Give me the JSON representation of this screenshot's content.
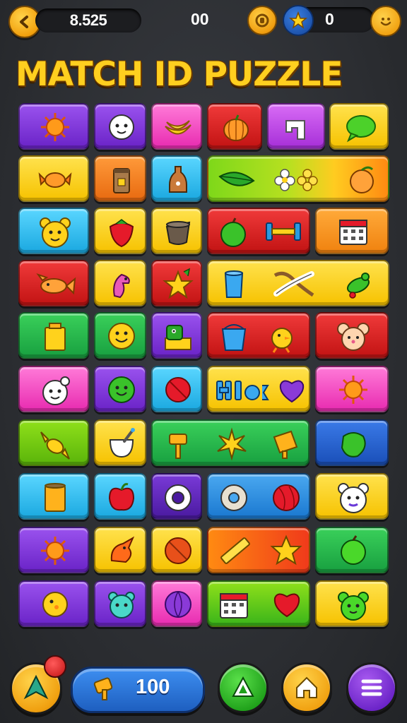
{
  "header": {
    "score": "8.525",
    "count": "00",
    "stars": "0"
  },
  "title": "MATCH ID PUZZLE",
  "footer": {
    "moves": "100"
  },
  "icons": {
    "back": "chevron-left-icon",
    "coin": "coin-icon",
    "star": "star-icon",
    "profile": "smiley-icon",
    "booster": "arrow-booster-icon",
    "hint": "triangle-hint-icon",
    "home": "home-icon",
    "menu": "hamburger-menu-icon"
  },
  "colors": {
    "purple": "#7a2fd6",
    "yellow": "#ffd21c",
    "pink": "#ff4fc8",
    "red": "#e01d1d",
    "blue": "#22b7ef",
    "orange": "#ff8a12",
    "green": "#34c22b",
    "lime": "#8fe01a"
  }
}
